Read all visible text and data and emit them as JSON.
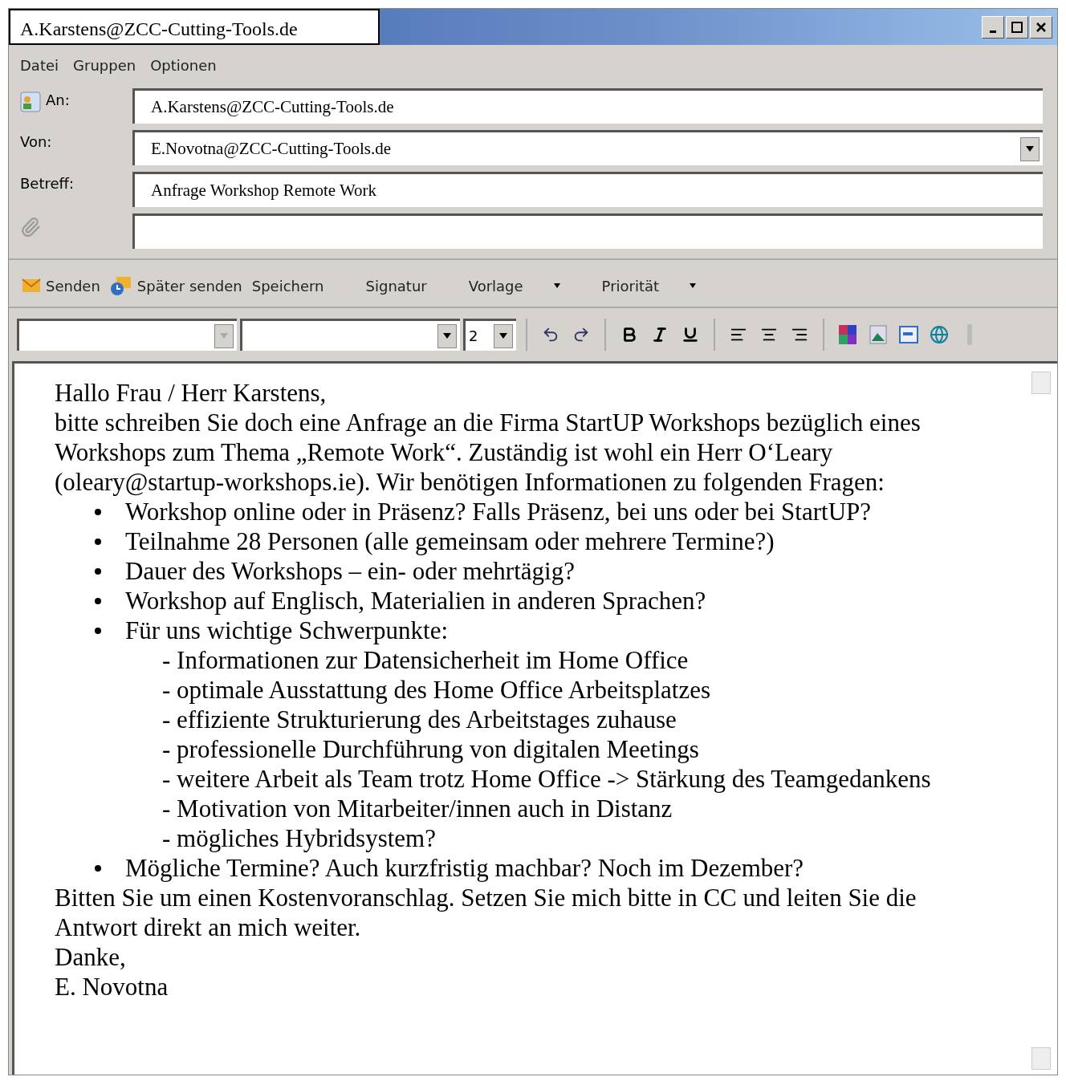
{
  "window": {
    "title": "A.Karstens@ZCC-Cutting-Tools.de"
  },
  "menu": [
    "Datei",
    "Gruppen",
    "Optionen"
  ],
  "fields": [
    {
      "kind": "recipient",
      "label": "An:",
      "value": "A.Karstens@ZCC-Cutting-Tools.de"
    },
    {
      "kind": "dropdown",
      "label": "Von:",
      "value": "E.Novotna@ZCC-Cutting-Tools.de"
    },
    {
      "kind": "text",
      "label": "Betreff:",
      "value": "Anfrage Workshop Remote Work"
    },
    {
      "kind": "attachment"
    }
  ],
  "toolbar": [
    {
      "kind": "send",
      "label": "Senden",
      "dropdown": false
    },
    {
      "kind": "later",
      "label": "Später senden",
      "dropdown": false
    },
    {
      "kind": "plain",
      "label": "Speichern",
      "dropdown": false
    },
    {
      "kind": "plain",
      "label": "Signatur",
      "dropdown": false
    },
    {
      "kind": "plain",
      "label": "Vorlage",
      "dropdown": true
    },
    {
      "kind": "plain",
      "label": "Priorität",
      "dropdown": true
    }
  ],
  "format_bar": {
    "font_size": "2"
  },
  "body": {
    "greeting": "Hallo Frau / Herr Karstens,",
    "intro": "bitte schreiben Sie doch eine Anfrage an die Firma StartUP Workshops bezüglich eines Workshops zum Thema „Remote Work“. Zuständig ist wohl ein Herr O‘Leary (oleary@startup-workshops.ie). Wir benötigen Informationen zu folgenden Fragen:",
    "bullets": [
      {
        "text": "Workshop online oder in Präsenz? Falls Präsenz, bei uns oder bei StartUP?"
      },
      {
        "text": "Teilnahme 28 Personen (alle gemeinsam oder mehrere Termine?)"
      },
      {
        "text": "Dauer des Workshops – ein- oder mehrtägig?"
      },
      {
        "text": "Workshop auf Englisch, Materialien in anderen Sprachen?"
      },
      {
        "text": "Für uns wichtige Schwerpunkte:",
        "children": [
          "- Informationen zur Datensicherheit im Home Office",
          "- optimale Ausstattung des Home Office Arbeitsplatzes",
          "- effiziente Strukturierung des Arbeitstages zuhause",
          "- professionelle Durchführung von digitalen Meetings",
          "- weitere Arbeit als Team trotz Home Office -> Stärkung des Teamgedankens",
          "- Motivation von Mitarbeiter/innen auch in Distanz",
          "- mögliches Hybridsystem?"
        ]
      },
      {
        "text": "Mögliche Termine? Auch kurzfristig machbar? Noch im Dezember?"
      }
    ],
    "closing": [
      "Bitten Sie um einen Kostenvoranschlag. Setzen Sie mich bitte in CC und leiten Sie die Antwort direkt an mich weiter.",
      "Danke,",
      "E. Novotna"
    ]
  }
}
